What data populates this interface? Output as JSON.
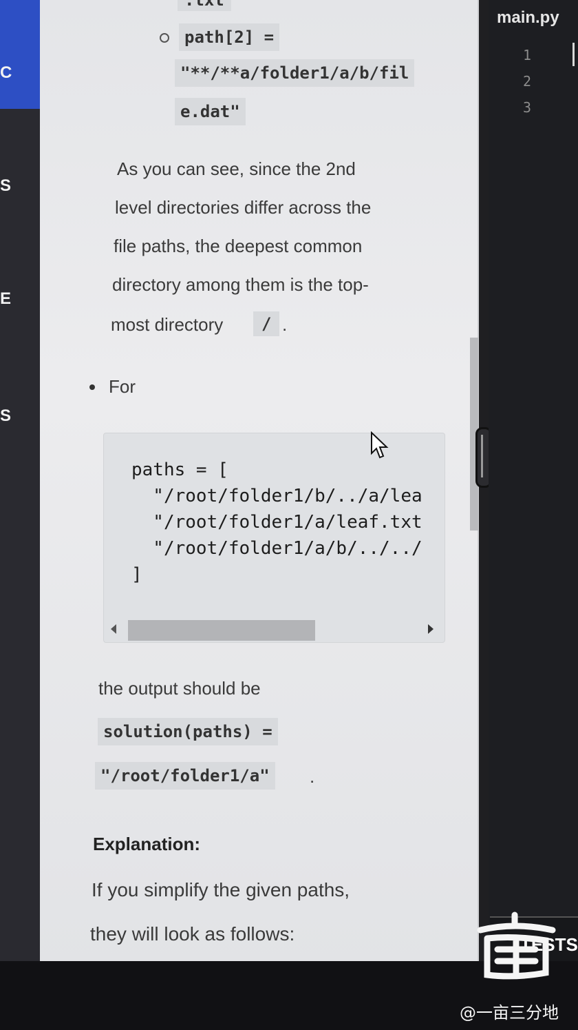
{
  "sidebar": {
    "letters": [
      "C",
      "S",
      "E",
      "S"
    ]
  },
  "description": {
    "prev_example": {
      "top_fragment": ".txt",
      "path2_label": "path[2] =",
      "path2_value_line1": "\"**/**a/folder1/a/b/fil",
      "path2_value_line2": "e.dat\""
    },
    "explain_lines": [
      "As you can see, since the 2nd",
      "level directories differ across the",
      "file paths, the deepest common",
      "directory among them is the top-",
      "most directory"
    ],
    "root_dir": "/",
    "period": ".",
    "bullet_for": "For",
    "code_lines": [
      "paths = [",
      "  \"/root/folder1/b/../a/lea",
      "  \"/root/folder1/a/leaf.txt",
      "  \"/root/folder1/a/b/../../",
      "]"
    ],
    "output_intro": "the output should be",
    "solution_call": "solution(paths) =",
    "solution_value": "\"/root/folder1/a\"",
    "explanation_heading": "Explanation:",
    "explanation_line1": "If you simplify the given paths,",
    "explanation_line2": "they will look as follows:"
  },
  "editor": {
    "tab_title": "main.py",
    "line_numbers": [
      "1",
      "2",
      "3"
    ],
    "tests_label": "TESTS"
  },
  "watermark": {
    "text": "@一亩三分地"
  }
}
